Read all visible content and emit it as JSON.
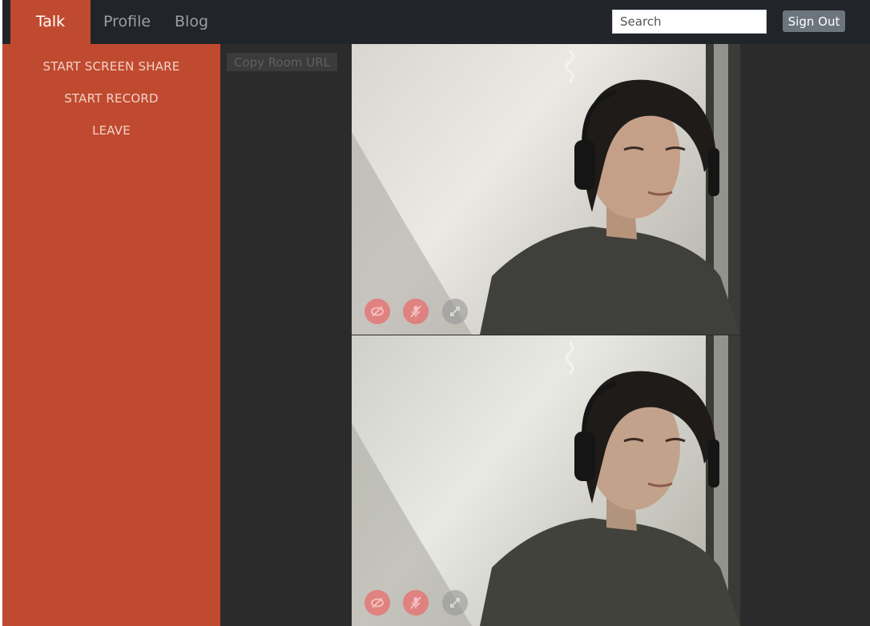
{
  "nav": {
    "tabs": [
      {
        "label": "Talk",
        "active": true
      },
      {
        "label": "Profile",
        "active": false
      },
      {
        "label": "Blog",
        "active": false
      }
    ],
    "search_placeholder": "Search",
    "signout_label": "Sign Out"
  },
  "sidebar": {
    "items": [
      {
        "label": "START SCREEN SHARE"
      },
      {
        "label": "START RECORD"
      },
      {
        "label": "LEAVE"
      }
    ]
  },
  "main": {
    "copy_url_label": "Copy Room URL",
    "videos": [
      {
        "controls": [
          "camera-off-icon",
          "mic-off-icon",
          "fullscreen-icon"
        ]
      },
      {
        "controls": [
          "camera-off-icon",
          "mic-off-icon",
          "fullscreen-icon"
        ]
      }
    ]
  },
  "colors": {
    "accent": "#c04a2f",
    "navbar": "#212529",
    "background": "#2b2b2b",
    "button_gray": "#6c757d",
    "control_red": "#e86c6c"
  }
}
